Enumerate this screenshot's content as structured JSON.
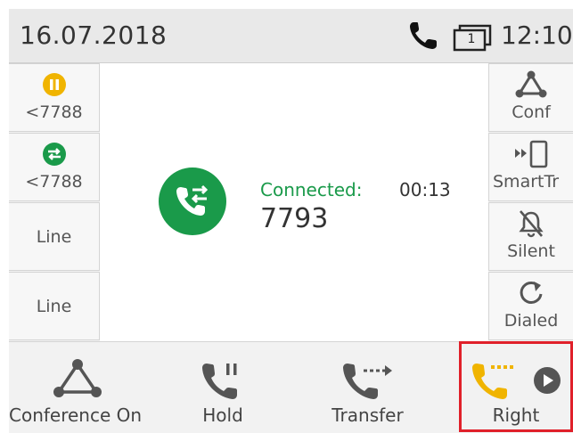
{
  "status_bar": {
    "date": "16.07.2018",
    "time": "12:10",
    "line_indicator": "1",
    "icons": [
      "phone-icon",
      "line-indicator-icon"
    ]
  },
  "left_keys": [
    {
      "label": "<7788",
      "icon": "hold-status-icon",
      "icon_color": "#f0b400"
    },
    {
      "label": "<7788",
      "icon": "active-call-status-icon",
      "icon_color": "#1a9a4a"
    },
    {
      "label": "Line"
    },
    {
      "label": "Line"
    }
  ],
  "right_keys": [
    {
      "label": "Conf",
      "icon": "conference-icon"
    },
    {
      "label": "SmartTr",
      "icon": "smart-transfer-icon"
    },
    {
      "label": "Silent",
      "icon": "bell-mute-icon"
    },
    {
      "label": "Dialed",
      "icon": "redial-icon"
    }
  ],
  "call": {
    "status": "Connected:",
    "duration": "00:13",
    "number": "7793",
    "avatar_icon": "call-swap-icon",
    "accent_color": "#1a9a4a"
  },
  "softkeys": [
    {
      "label": "Conference On",
      "icon": "conference-icon"
    },
    {
      "label": "Hold",
      "icon": "hold-icon"
    },
    {
      "label": "Transfer",
      "icon": "transfer-icon"
    },
    {
      "label": "Right",
      "icon": "next-call-icon",
      "accent": "#f0b400",
      "highlighted": true
    }
  ],
  "colors": {
    "highlight_border": "#e0202a",
    "hold_yellow": "#f0b400",
    "connected_green": "#1a9a4a"
  }
}
